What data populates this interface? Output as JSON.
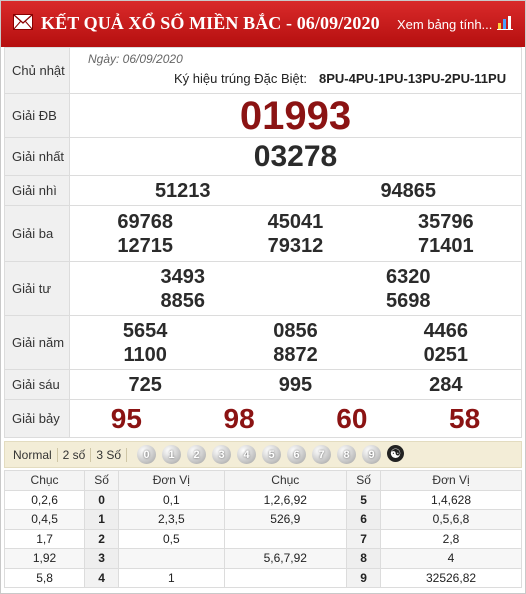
{
  "header": {
    "title": "KẾT QUẢ XỔ SỐ MIỀN BẮC - 06/09/2020",
    "view_link": "Xem bảng tính..."
  },
  "info": {
    "weekday": "Chủ nhật",
    "date": "Ngày: 06/09/2020",
    "kyhieu_label": "Ký hiệu trúng Đặc Biệt:",
    "kyhieu_value": "8PU-4PU-1PU-13PU-2PU-11PU"
  },
  "prizes": {
    "db": {
      "label": "Giải ĐB",
      "values": [
        "01993"
      ]
    },
    "g1": {
      "label": "Giải nhất",
      "values": [
        "03278"
      ]
    },
    "g2": {
      "label": "Giải nhì",
      "values": [
        "51213",
        "94865"
      ]
    },
    "g3": {
      "label": "Giải ba",
      "values": [
        "69768",
        "45041",
        "35796",
        "12715",
        "79312",
        "71401"
      ]
    },
    "g4": {
      "label": "Giải tư",
      "values": [
        "3493",
        "6320",
        "8856",
        "5698"
      ]
    },
    "g5": {
      "label": "Giải năm",
      "values": [
        "5654",
        "0856",
        "4466",
        "1100",
        "8872",
        "0251"
      ]
    },
    "g6": {
      "label": "Giải sáu",
      "values": [
        "725",
        "995",
        "284"
      ]
    },
    "g7": {
      "label": "Giải bảy",
      "values": [
        "95",
        "98",
        "60",
        "58"
      ]
    }
  },
  "filter": {
    "options": [
      "Normal",
      "2 số",
      "3 Số"
    ],
    "digits": [
      "0",
      "1",
      "2",
      "3",
      "4",
      "5",
      "6",
      "7",
      "8",
      "9"
    ],
    "yinyang_icon": "yin-yang-icon"
  },
  "loto": {
    "headers": [
      "Chục",
      "Số",
      "Đơn Vị",
      "Chục",
      "Số",
      "Đơn Vị"
    ],
    "rows": [
      [
        "0,2,6",
        "0",
        "0,1",
        "1,2,6,92",
        "5",
        "1,4,628"
      ],
      [
        "0,4,5",
        "1",
        "2,3,5",
        "526,9",
        "6",
        "0,5,6,8"
      ],
      [
        "1,7",
        "2",
        "0,5",
        "",
        "7",
        "2,8"
      ],
      [
        "1,92",
        "3",
        "",
        "5,6,7,92",
        "8",
        "4"
      ],
      [
        "5,8",
        "4",
        "1",
        "",
        "9",
        "32526,82"
      ]
    ]
  },
  "colors": {
    "header_red": "#c41818",
    "prize_red": "#8b1313",
    "filter_bg": "#f3edd7"
  }
}
